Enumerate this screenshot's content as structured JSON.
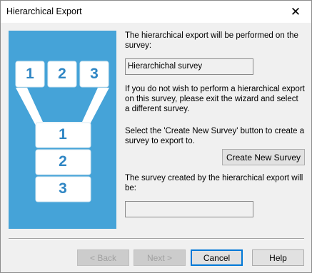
{
  "window": {
    "title": "Hierarchical Export",
    "close_glyph": "✕"
  },
  "graphic": {
    "top_labels": [
      "1",
      "2",
      "3"
    ],
    "bottom_labels": [
      "1",
      "2",
      "3"
    ]
  },
  "content": {
    "intro_text": "The hierarchical export will be performed on the survey:",
    "current_survey_value": "Hierarchichal survey",
    "exit_text": "If you do not wish to perform a hierarchical export on this survey, please exit the wizard and select a different survey.",
    "create_text": "Select the 'Create New Survey' button to create a survey to export to.",
    "create_button": "Create New Survey",
    "result_text": "The survey created by the hierarchical export will be:",
    "result_survey_value": ""
  },
  "footer": {
    "back": "< Back",
    "next": "Next >",
    "cancel": "Cancel",
    "help": "Help"
  },
  "colors": {
    "graphic_bg": "#45a3d8",
    "number": "#2f86c4",
    "accent": "#0078d7"
  }
}
